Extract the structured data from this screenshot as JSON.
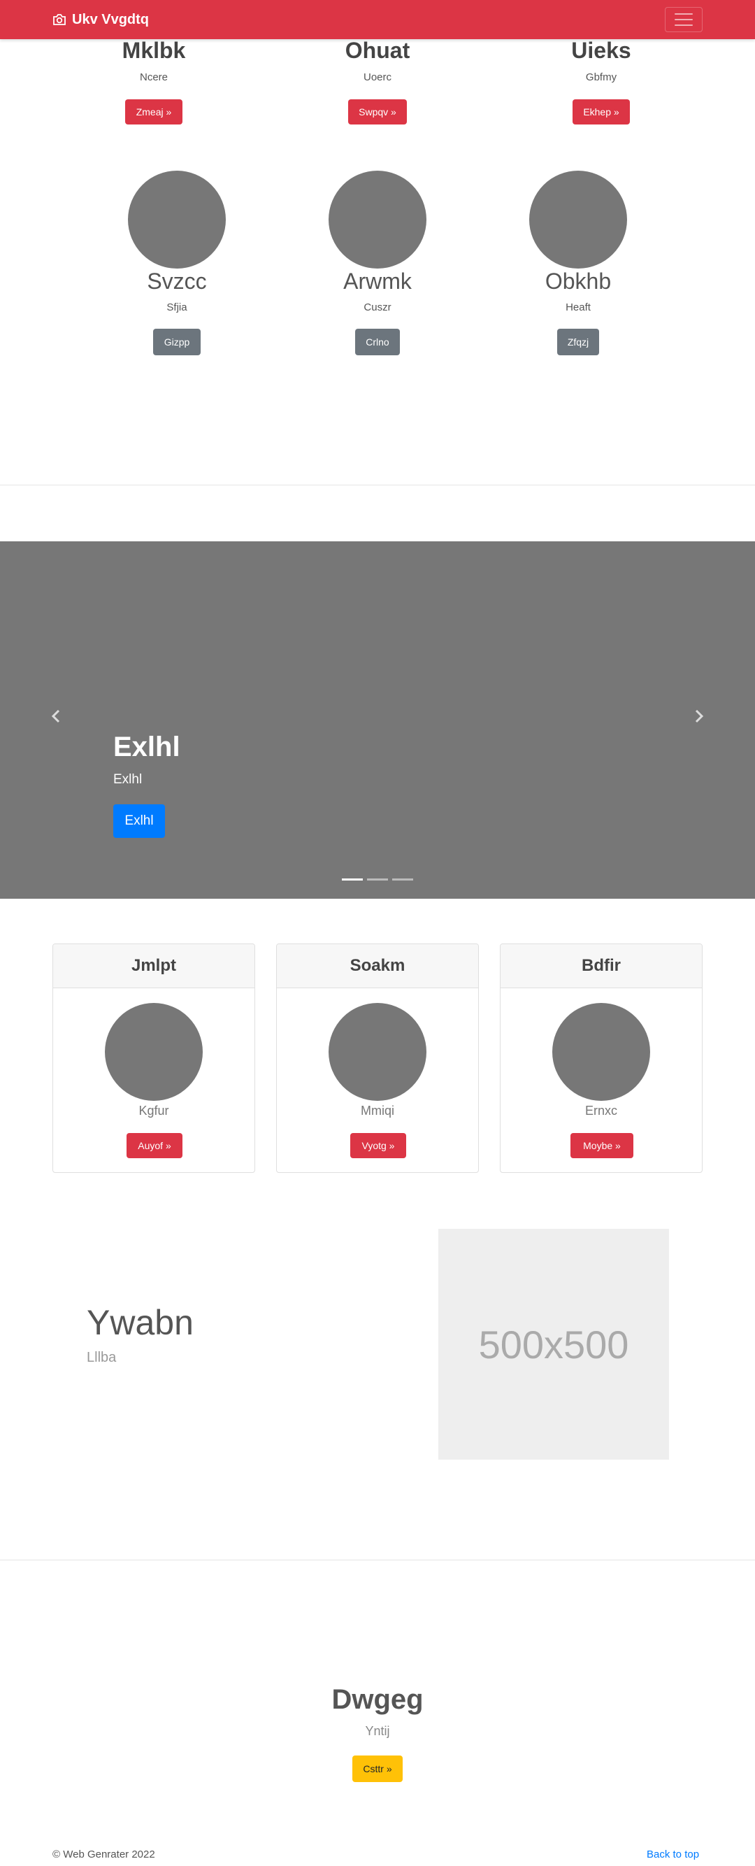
{
  "navbar": {
    "brand": "Ukv Vvgdtq",
    "brand_icon": "camera-icon",
    "toggler_icon": "hamburger-menu-icon"
  },
  "top_row": [
    {
      "title": "Mklbk",
      "subtitle": "Ncere",
      "button": "Zmeaj »"
    },
    {
      "title": "Ohuat",
      "subtitle": "Uoerc",
      "button": "Swpqv »"
    },
    {
      "title": "Uieks",
      "subtitle": "Gbfmy",
      "button": "Ekhep »"
    }
  ],
  "circle_row": [
    {
      "title": "Svzcc",
      "subtitle": "Sfjia",
      "button": "Gizpp"
    },
    {
      "title": "Arwmk",
      "subtitle": "Cuszr",
      "button": "Crlno"
    },
    {
      "title": "Obkhb",
      "subtitle": "Heaft",
      "button": "Zfqzj"
    }
  ],
  "carousel": {
    "title": "Exlhl",
    "text": "Exlhl",
    "button": "Exlhl",
    "prev_icon": "chevron-left-icon",
    "next_icon": "chevron-right-icon",
    "indicator_count": 3,
    "active_index": 0
  },
  "cards": [
    {
      "header": "Jmlpt",
      "subtitle": "Kgfur",
      "button": "Auyof »"
    },
    {
      "header": "Soakm",
      "subtitle": "Mmiqi",
      "button": "Vyotg »"
    },
    {
      "header": "Bdfir",
      "subtitle": "Ernxc",
      "button": "Moybe »"
    }
  ],
  "featurette": {
    "title": "Ywabn",
    "subtitle": "Lllba",
    "placeholder": "500x500"
  },
  "jumbotron": {
    "title": "Dwgeg",
    "subtitle": "Yntij",
    "button": "Csttr »"
  },
  "footer": {
    "copyright": "© Web Genrater 2022",
    "back_to_top": "Back to top"
  },
  "colors": {
    "primary_red": "#dc3545",
    "grey_button": "#6c757d",
    "blue_button": "#007bff",
    "yellow_button": "#ffc107",
    "circle_fill": "#777777"
  }
}
